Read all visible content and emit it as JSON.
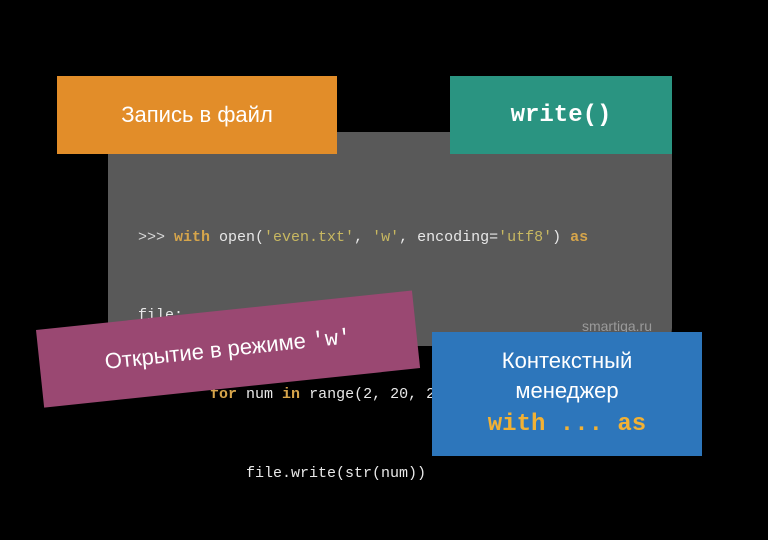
{
  "code": {
    "line1": {
      "prompt": ">>> ",
      "kw1": "with",
      "open": " open(",
      "arg1": "'even.txt'",
      "sep1": ", ",
      "arg2": "'w'",
      "sep2": ", encoding=",
      "arg3": "'utf8'",
      "close": ") ",
      "kw2": "as"
    },
    "line2": "file:",
    "line3": {
      "kw1": "for",
      "mid1": " num ",
      "kw2": "in",
      "mid2": " range(",
      "n1": "2",
      "c1": ", ",
      "n2": "20",
      "c2": ", ",
      "n3": "2",
      "tail": "):"
    },
    "line4": "file.write(str(num))",
    "indent1": "        ",
    "indent2": "            "
  },
  "watermark": "smartiqa.ru",
  "labels": {
    "orange": "Запись в файл",
    "teal": "write()",
    "magenta_prefix": "Открытие в режиме ",
    "magenta_mono": "'w'",
    "blue_line1": "Контекстный",
    "blue_line2": "менеджер",
    "blue_mono": "with ... as"
  }
}
